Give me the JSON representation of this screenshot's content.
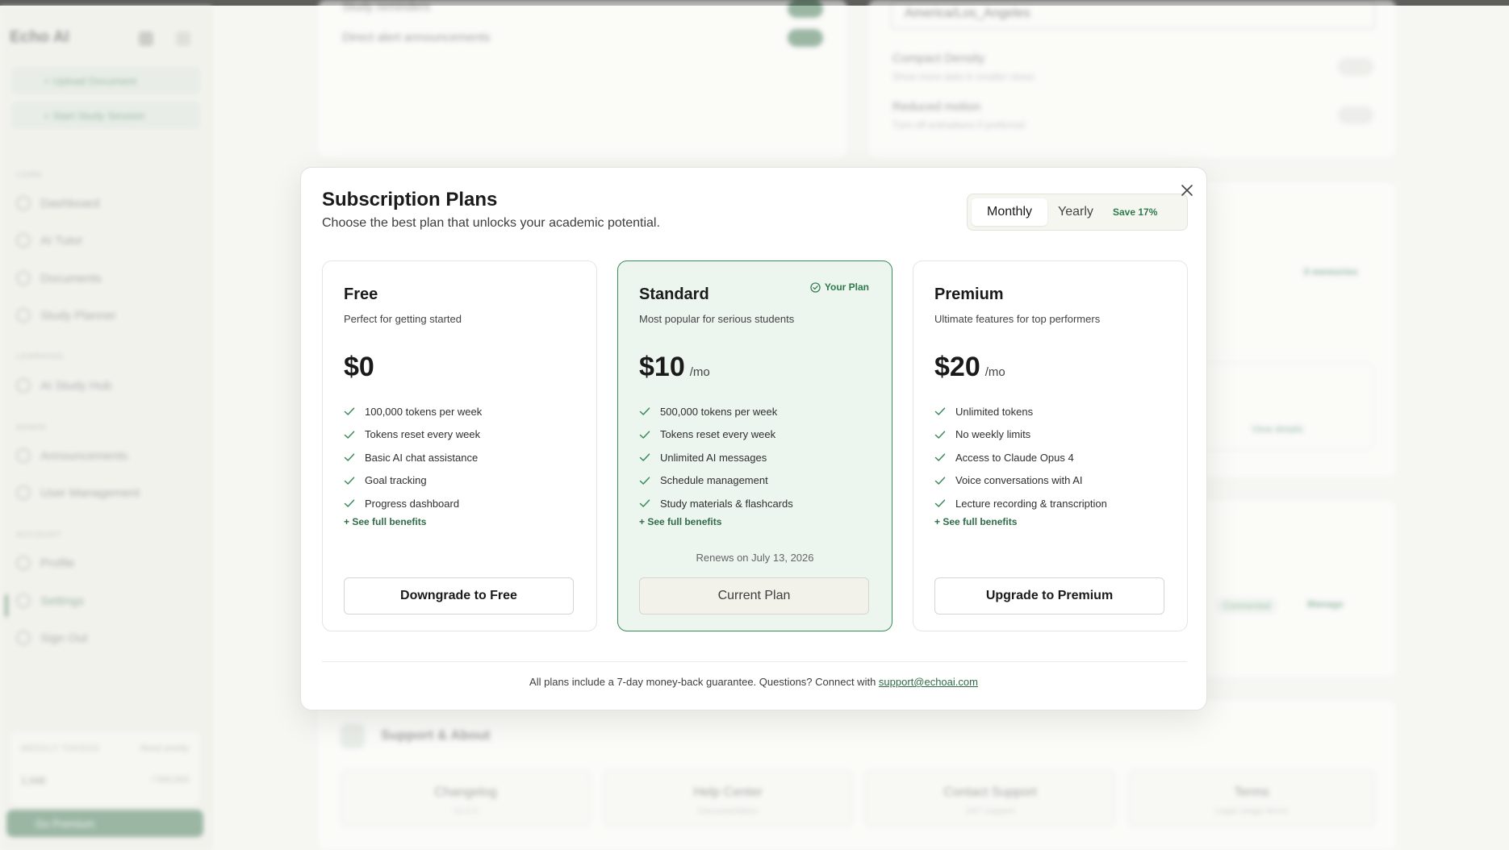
{
  "app": {
    "brand": "Echo AI",
    "sidebar": {
      "actions": [
        "+ Upload Document",
        "+ Start Study Session"
      ],
      "sections": [
        {
          "label": "CORE",
          "items": [
            "Dashboard",
            "AI Tutor",
            "Documents",
            "Study Planner"
          ]
        },
        {
          "label": "LEARNING",
          "items": [
            "AI Study Hub"
          ]
        },
        {
          "label": "ADMIN",
          "items": [
            "Announcements",
            "User Management"
          ]
        },
        {
          "label": "ACCOUNT",
          "items": [
            "Profile",
            "Settings",
            "Sign Out"
          ]
        }
      ],
      "usage_label": "WEEKLY TOKENS",
      "usage_reset": "Reset weekly",
      "usage_used": "1,048",
      "usage_total": "/ 500,000",
      "premium_button": "Go Premium"
    },
    "settings": {
      "study_reminders": "Study reminders",
      "direct_alerts": "Direct alert announcements",
      "timezone": "America/Los_Angeles",
      "compact_density": "Compact Density",
      "compact_density_desc": "Show more data in smaller views",
      "reduced_motion": "Reduced motion",
      "reduced_motion_desc": "Turn off animations if preferred",
      "memories_badge": "0 memories",
      "view_details": "View details",
      "connected": "Connected",
      "manage": "Manage",
      "support_title": "Support & About",
      "tiles": [
        {
          "title": "Changelog",
          "sub": "v1.0.0"
        },
        {
          "title": "Help Center",
          "sub": "Documentation"
        },
        {
          "title": "Contact Support",
          "sub": "24/7 support"
        },
        {
          "title": "Terms",
          "sub": "Legal usage terms"
        }
      ]
    }
  },
  "modal": {
    "title": "Subscription Plans",
    "subtitle": "Choose the best plan that unlocks your academic potential.",
    "billing": {
      "monthly": "Monthly",
      "yearly": "Yearly",
      "save": "Save 17%",
      "selected": "monthly"
    },
    "plans": [
      {
        "name": "Free",
        "description": "Perfect for getting started",
        "price": "$0",
        "period": "",
        "features": [
          "100,000 tokens per week",
          "Tokens reset every week",
          "Basic AI chat assistance",
          "Goal tracking",
          "Progress dashboard"
        ],
        "see_benefits": "+ See full benefits",
        "button": "Downgrade to Free"
      },
      {
        "name": "Standard",
        "description": "Most popular for serious students",
        "price": "$10",
        "period": "/mo",
        "badge": "Your Plan",
        "features": [
          "500,000 tokens per week",
          "Tokens reset every week",
          "Unlimited AI messages",
          "Schedule management",
          "Study materials & flashcards"
        ],
        "see_benefits": "+ See full benefits",
        "renews": "Renews on July 13, 2026",
        "button": "Current Plan"
      },
      {
        "name": "Premium",
        "description": "Ultimate features for top performers",
        "price": "$20",
        "period": "/mo",
        "features": [
          "Unlimited tokens",
          "No weekly limits",
          "Access to Claude Opus 4",
          "Voice conversations with AI",
          "Lecture recording & transcription"
        ],
        "see_benefits": "+ See full benefits",
        "button": "Upgrade to Premium"
      }
    ],
    "footer_text": "All plans include a 7-day money-back guarantee. Questions? Connect with ",
    "footer_link": "support@echoai.com"
  },
  "colors": {
    "accent": "#2e6b46",
    "current_plan_bg": "#edf5ef",
    "check": "#3a8a5a"
  },
  "icons": {
    "close": "close-icon",
    "check": "check-icon",
    "badge": "check-circle-icon"
  }
}
